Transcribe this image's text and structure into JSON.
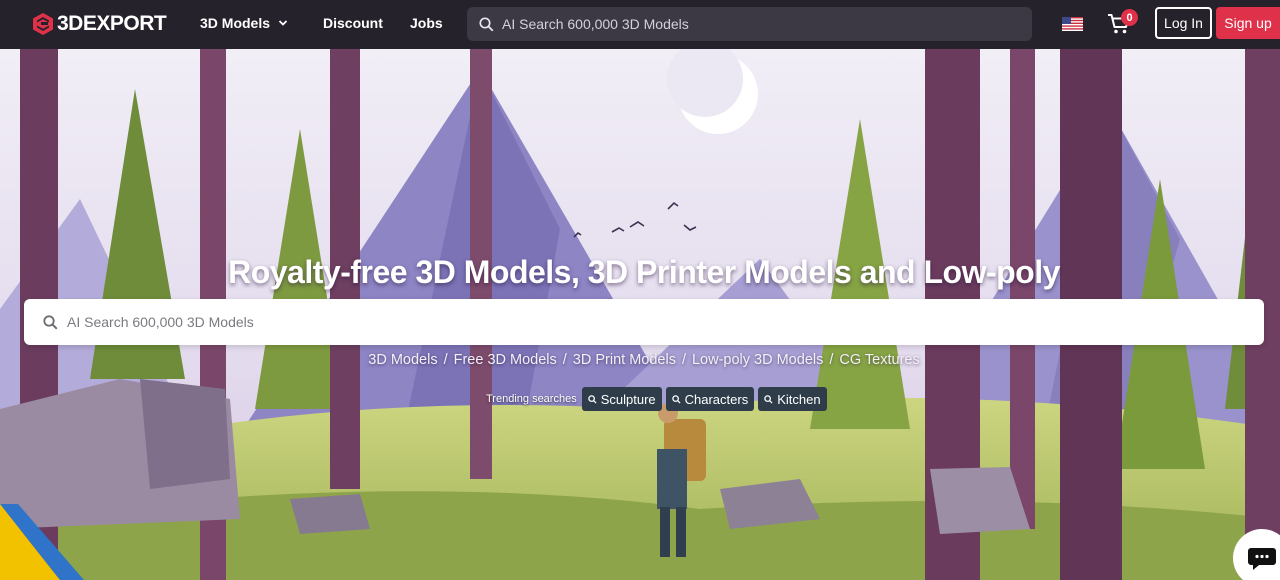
{
  "header": {
    "logo_text": "3DEXPORT",
    "nav": [
      {
        "label": "3D Models",
        "has_dropdown": true
      },
      {
        "label": "Discount"
      },
      {
        "label": "Jobs"
      }
    ],
    "search_placeholder": "AI Search 600,000 3D Models",
    "locale_flag": "us-flag-icon",
    "cart_count": "0",
    "login_label": "Log In",
    "signup_label": "Sign up"
  },
  "hero": {
    "title": "Royalty-free 3D Models, 3D Printer Models and Low-poly",
    "search_placeholder": "AI Search 600,000 3D Models",
    "categories": [
      "3D Models",
      "Free 3D Models",
      "3D Print Models",
      "Low-poly 3D Models",
      "CG Textures"
    ],
    "trending_label": "Trending searches",
    "trending": [
      "Sculpture",
      "Characters",
      "Kitchen"
    ]
  },
  "colors": {
    "header_bg": "#25222b",
    "accent": "#e0314b",
    "chip_bg": "#2f3d4a"
  },
  "icons": {
    "chat": "chat-bubble-icon",
    "cart": "cart-icon",
    "search": "search-icon"
  }
}
